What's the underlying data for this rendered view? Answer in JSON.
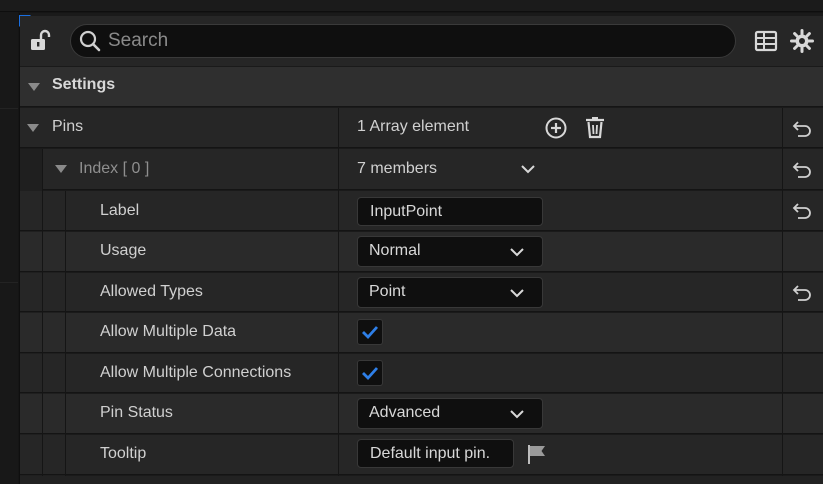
{
  "search": {
    "placeholder": "Search"
  },
  "settings": {
    "title": "Settings"
  },
  "pins": {
    "label": "Pins",
    "summary": "1 Array element"
  },
  "index": {
    "label_prefix": "Index",
    "label_index": "[ 0 ]",
    "summary": "7 members"
  },
  "properties": [
    {
      "label": "Label",
      "kind": "text",
      "value": "InputPoint",
      "has_reset": true
    },
    {
      "label": "Usage",
      "kind": "combo",
      "value": "Normal",
      "has_reset": false
    },
    {
      "label": "Allowed Types",
      "kind": "combo",
      "value": "Point",
      "has_reset": true
    },
    {
      "label": "Allow Multiple Data",
      "kind": "checkbox",
      "value": true,
      "has_reset": false
    },
    {
      "label": "Allow Multiple Connections",
      "kind": "checkbox",
      "value": true,
      "has_reset": false
    },
    {
      "label": "Pin Status",
      "kind": "combo",
      "value": "Advanced",
      "has_reset": false
    },
    {
      "label": "Tooltip",
      "kind": "text",
      "value": "Default input pin.",
      "has_reset": false
    }
  ],
  "colors": {
    "accent": "#1a6fe0",
    "check": "#2e7fe8",
    "panel": "#262626"
  },
  "icons": [
    "lock-open-icon",
    "search-icon",
    "table-view-icon",
    "gear-icon",
    "add-element-icon",
    "delete-icon",
    "reset-arrow-icon",
    "chevron-down-icon",
    "check-icon",
    "flag-icon"
  ]
}
